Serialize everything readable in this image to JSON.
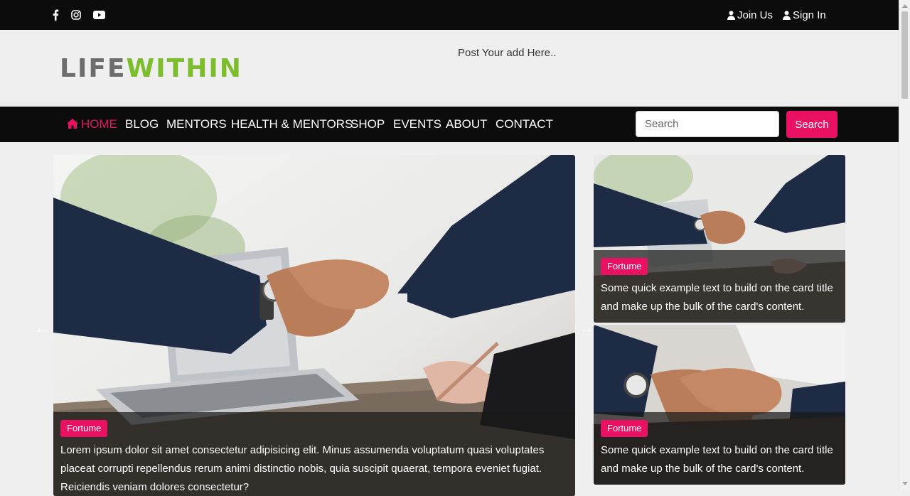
{
  "topbar": {
    "social": [
      "facebook-icon",
      "instagram-icon",
      "youtube-icon"
    ],
    "join_label": "Join Us",
    "signin_label": "Sign In"
  },
  "header": {
    "logo_part1": "LIFE",
    "logo_part2": "WITHIN",
    "ad_text": "Post Your add Here.."
  },
  "nav": {
    "items": [
      "HOME",
      "BLOG",
      "MENTORS",
      "HEALTH & MENTORS",
      "SHOP",
      "EVENTS",
      "ABOUT",
      "CONTACT"
    ],
    "search_placeholder": "Search",
    "search_button": "Search"
  },
  "carousel": {
    "prev_arrow": "←",
    "next_arrow": "→"
  },
  "main_card": {
    "badge": "Fortume",
    "text": "Lorem ipsum dolor sit amet consectetur adipisicing elit. Minus assumenda voluptatum quasi voluptates placeat corrupti repellendus rerum animi distinctio nobis, quia suscipit quaerat, tempora eveniet fugiat. Reiciendis veniam dolores consectetur?"
  },
  "side_cards": [
    {
      "badge": "Fortume",
      "text": "Some quick example text to build on the card title and make up the bulk of the card's content."
    },
    {
      "badge": "Fortume",
      "text": "Some quick example text to build on the card title and make up the bulk of the card's content."
    }
  ],
  "colors": {
    "accent": "#ea1163",
    "logo_green": "#7cbd2c",
    "logo_gray": "#6d6d6d",
    "bar": "#0c0c0c"
  }
}
